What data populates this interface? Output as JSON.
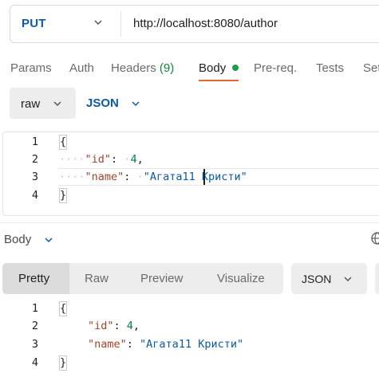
{
  "request": {
    "method": "PUT",
    "url": "http://localhost:8080/author",
    "tabs": [
      {
        "label": "Params"
      },
      {
        "label": "Auth"
      },
      {
        "label": "Headers",
        "count": "(9)"
      },
      {
        "label": "Body"
      },
      {
        "label": "Pre-req."
      },
      {
        "label": "Tests"
      },
      {
        "label": "Set"
      }
    ],
    "body_mode": "raw",
    "body_format": "JSON",
    "editor": {
      "line_numbers": [
        "1",
        "2",
        "3",
        "4"
      ],
      "open_brace": "{",
      "close_brace": "}",
      "id_key": "\"id\"",
      "id_value": "4",
      "name_key": "\"name\"",
      "name_value_part1": "\"Агата11",
      "name_value_part2": " Кристи\""
    }
  },
  "response": {
    "label": "Body",
    "view_tabs": [
      {
        "label": "Pretty"
      },
      {
        "label": "Raw"
      },
      {
        "label": "Preview"
      },
      {
        "label": "Visualize"
      }
    ],
    "format": "JSON",
    "editor": {
      "line_numbers": [
        "1",
        "2",
        "3",
        "4"
      ],
      "open_brace": "{",
      "close_brace": "}",
      "id_key": "\"id\"",
      "id_value": "4",
      "name_key": "\"name\"",
      "name_value": "\"Агата11 Кристи\""
    }
  },
  "colors": {
    "accent_tab": "#e8672f",
    "method_blue": "#0b5aab",
    "status_dot": "#1c9c4a"
  }
}
